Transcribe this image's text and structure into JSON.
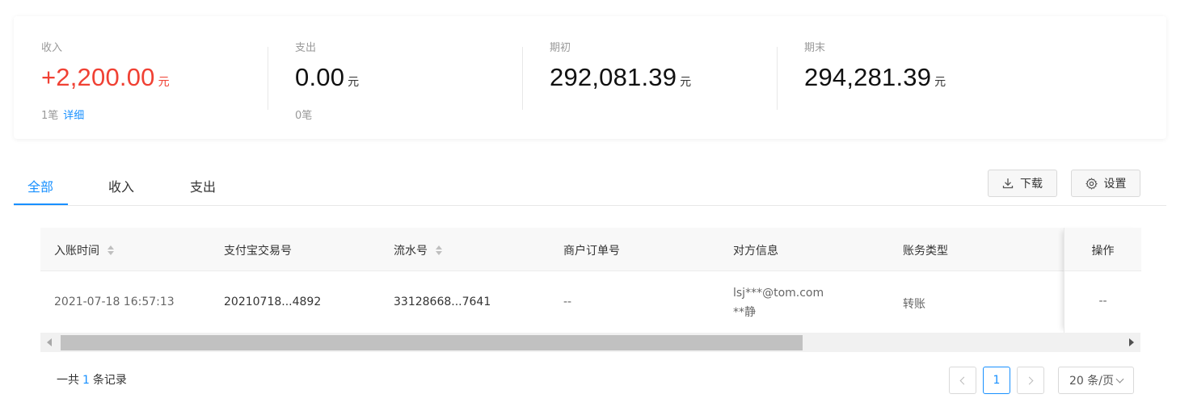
{
  "summary": {
    "income": {
      "label": "收入",
      "amount": "+2,200.00",
      "unit": "元",
      "count": "1笔",
      "detail_link": "详细"
    },
    "expense": {
      "label": "支出",
      "amount": "0.00",
      "unit": "元",
      "count": "0笔"
    },
    "opening": {
      "label": "期初",
      "amount": "292,081.39",
      "unit": "元"
    },
    "closing": {
      "label": "期末",
      "amount": "294,281.39",
      "unit": "元"
    }
  },
  "tabs": [
    {
      "label": "全部",
      "active": true
    },
    {
      "label": "收入",
      "active": false
    },
    {
      "label": "支出",
      "active": false
    }
  ],
  "toolbar": {
    "download_label": "下载",
    "settings_label": "设置",
    "download_icon": "download-icon",
    "settings_icon": "gear-icon"
  },
  "table": {
    "columns": [
      "入账时间",
      "支付宝交易号",
      "流水号",
      "商户订单号",
      "对方信息",
      "账务类型",
      "操作"
    ],
    "rows": [
      {
        "time": "2021-07-18 16:57:13",
        "alipay_no": "20210718...4892",
        "serial_no": "33128668...7641",
        "merchant_order": "--",
        "counterparty_account": "lsj***@tom.com",
        "counterparty_name": "**静",
        "type": "转账",
        "action": "--"
      }
    ]
  },
  "scrollbar": {
    "position": 0.0,
    "visible_fraction": 0.7
  },
  "footer": {
    "total_prefix": "一共",
    "total_count": "1",
    "total_suffix": "条记录",
    "current_page": "1",
    "page_size": "20 条/页"
  },
  "colors": {
    "accent": "#1890ff",
    "income": "#f04134"
  }
}
